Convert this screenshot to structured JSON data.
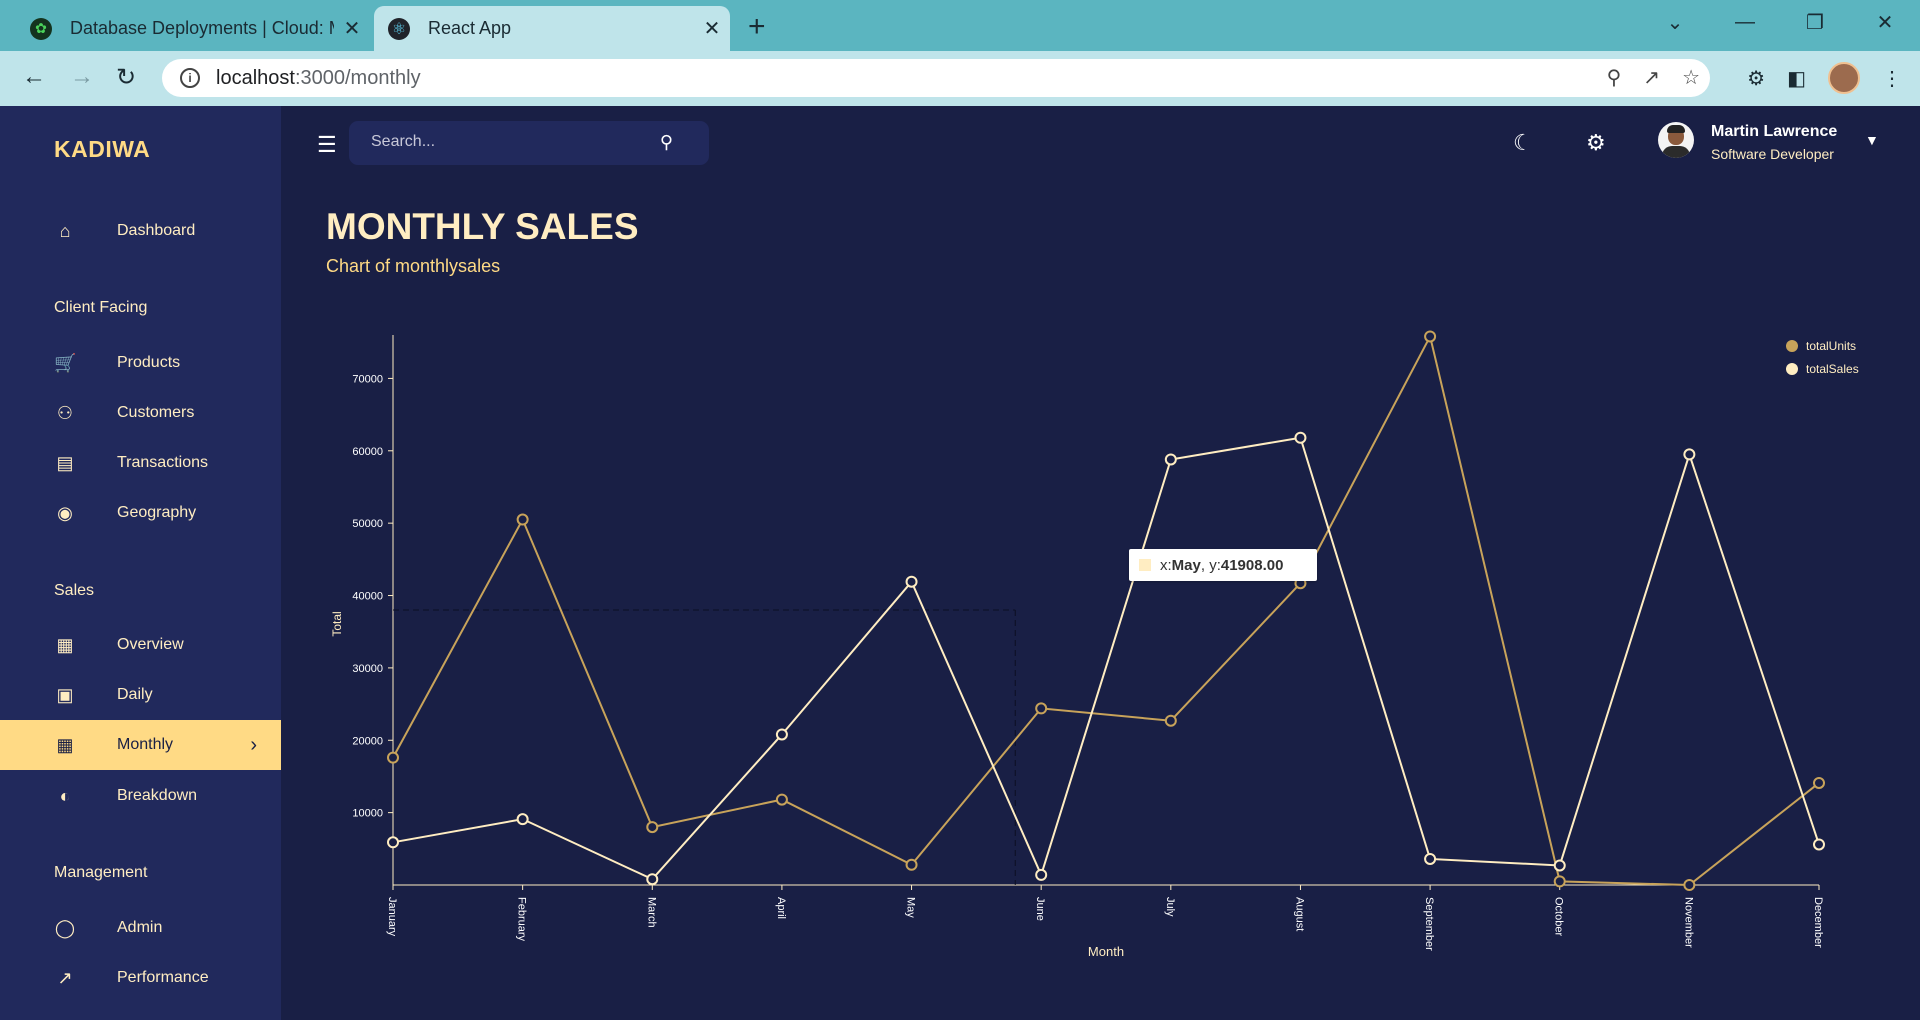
{
  "browser": {
    "tabs": [
      {
        "title": "Database Deployments | Cloud: M",
        "favicon": "mongodb-leaf-icon"
      },
      {
        "title": "React App",
        "favicon": "react-icon"
      }
    ],
    "url_host": "localhost",
    "url_path": ":3000/monthly"
  },
  "app": {
    "brand": "KADIWA",
    "search_placeholder": "Search...",
    "user": {
      "name": "Martin Lawrence",
      "role": "Software Developer"
    },
    "page_title": "MONTHLY SALES",
    "page_subtitle": "Chart of monthlysales"
  },
  "sidebar": {
    "items": [
      {
        "label": "Dashboard",
        "icon": "home-icon"
      },
      {
        "section": "Client Facing"
      },
      {
        "label": "Products",
        "icon": "cart-icon"
      },
      {
        "label": "Customers",
        "icon": "groups-icon"
      },
      {
        "label": "Transactions",
        "icon": "receipt-icon"
      },
      {
        "label": "Geography",
        "icon": "globe-icon"
      },
      {
        "section": "Sales"
      },
      {
        "label": "Overview",
        "icon": "point-of-sale-icon"
      },
      {
        "label": "Daily",
        "icon": "calendar-today-icon"
      },
      {
        "label": "Monthly",
        "icon": "calendar-month-icon",
        "active": true
      },
      {
        "label": "Breakdown",
        "icon": "pie-chart-icon"
      },
      {
        "section": "Management"
      },
      {
        "label": "Admin",
        "icon": "admin-icon"
      },
      {
        "label": "Performance",
        "icon": "trending-up-icon"
      }
    ]
  },
  "colors": {
    "background": "#191f45",
    "sidebar": "#21295c",
    "accent": "#ffda85",
    "text_light": "#ffedc2",
    "series_units": "#c8a35a",
    "series_sales": "#ffedc2"
  },
  "tooltip": {
    "x_prefix": "x: ",
    "x": "May",
    "y_prefix": ", y: ",
    "y": "41908.00"
  },
  "chart_data": {
    "type": "line",
    "title": "",
    "xlabel": "Month",
    "ylabel": "Total",
    "categories": [
      "January",
      "February",
      "March",
      "April",
      "May",
      "June",
      "July",
      "August",
      "September",
      "October",
      "November",
      "December"
    ],
    "y_ticks": [
      10000,
      20000,
      30000,
      40000,
      50000,
      60000,
      70000
    ],
    "ylim": [
      0,
      76000
    ],
    "legend_position": "top-right",
    "grid": false,
    "series": [
      {
        "name": "totalUnits",
        "values": [
          17600,
          50500,
          8000,
          11800,
          2800,
          24400,
          22700,
          41700,
          75800,
          500,
          0,
          14100
        ]
      },
      {
        "name": "totalSales",
        "values": [
          5900,
          9100,
          800,
          20800,
          41908,
          1400,
          58800,
          61800,
          3600,
          2700,
          59500,
          5600
        ]
      }
    ]
  }
}
